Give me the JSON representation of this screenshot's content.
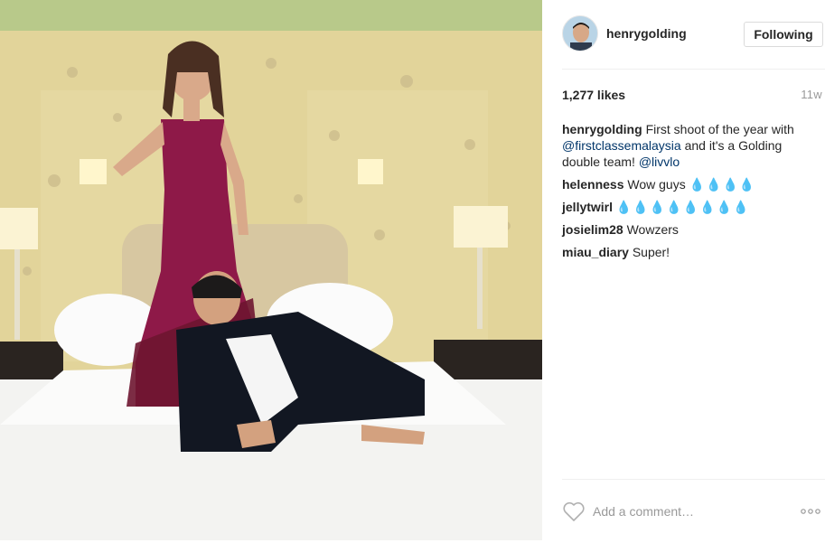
{
  "post": {
    "author": "henrygolding",
    "follow_label": "Following",
    "likes": "1,277 likes",
    "timestamp": "11w",
    "caption": {
      "user": "henrygolding",
      "text_1": "First shoot of the year with ",
      "mention_1": "@firstclassemalaysia",
      "text_2": " and it's a Golding double team! ",
      "mention_2": "@livvlo"
    },
    "comments": [
      {
        "user": "helenness",
        "text": "Wow guys",
        "drops": "💧💧💧💧"
      },
      {
        "user": "jellytwirl",
        "text": "",
        "drops": "💧💧💧💧💧💧💧💧"
      },
      {
        "user": "josielim28",
        "text": "Wowzers",
        "drops": ""
      },
      {
        "user": "miau_diary",
        "text": "Super!",
        "drops": ""
      }
    ],
    "add_comment_placeholder": "Add a comment…",
    "icons": {
      "like": "heart-outline-icon",
      "more": "more-options-icon",
      "avatar": "profile-avatar"
    }
  }
}
